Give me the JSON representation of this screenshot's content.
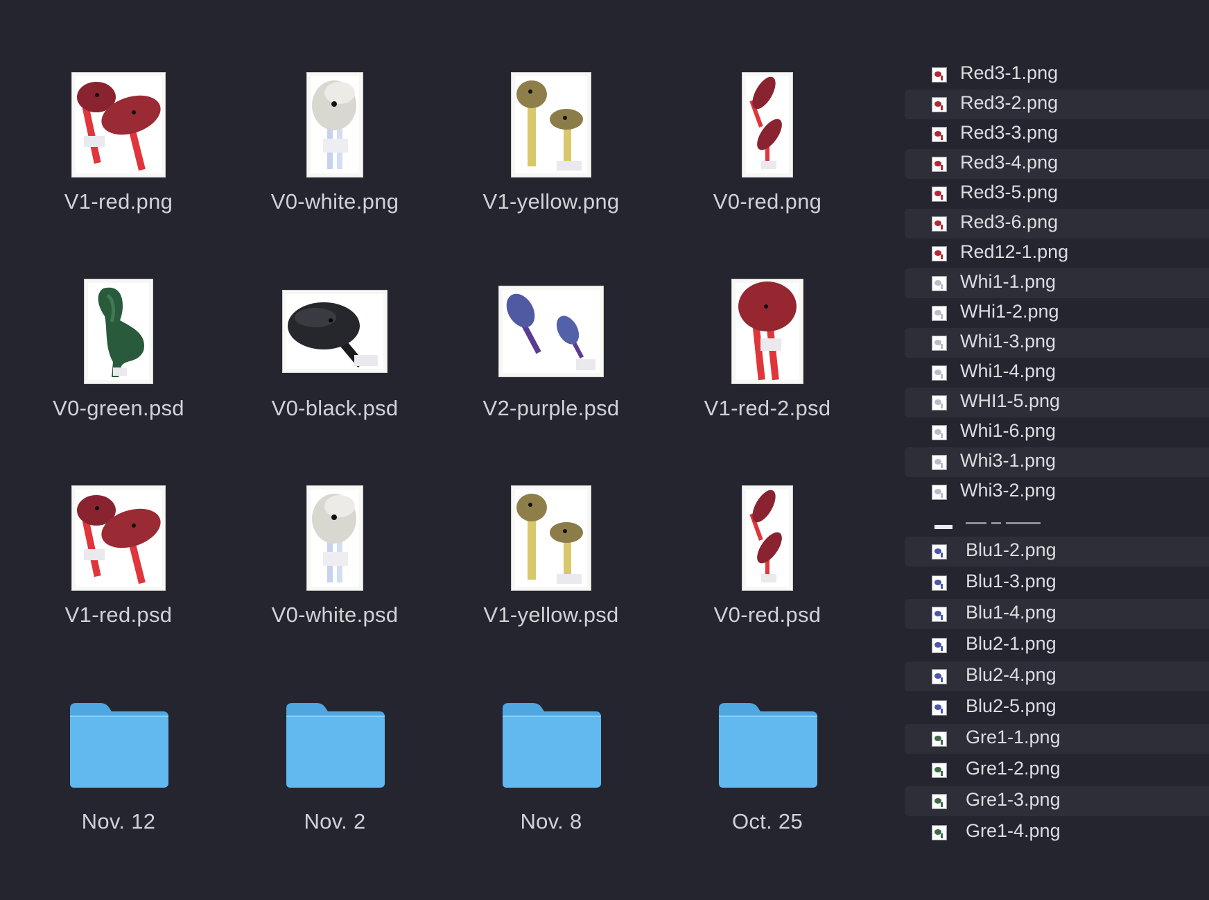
{
  "icon_grid": {
    "items": [
      {
        "name": "V1-red.png",
        "kind": "thumb-red-two-holds"
      },
      {
        "name": "V0-white.png",
        "kind": "thumb-white-hold"
      },
      {
        "name": "V1-yellow.png",
        "kind": "thumb-yellow-two-holds"
      },
      {
        "name": "V0-red.png",
        "kind": "thumb-red-narrow"
      },
      {
        "name": "V0-green.psd",
        "kind": "thumb-green-hold"
      },
      {
        "name": "V0-black.psd",
        "kind": "thumb-black-hold"
      },
      {
        "name": "V2-purple.psd",
        "kind": "thumb-purple-holds"
      },
      {
        "name": "V1-red-2.psd",
        "kind": "thumb-red-single"
      },
      {
        "name": "V1-red.psd",
        "kind": "thumb-red-two-holds"
      },
      {
        "name": "V0-white.psd",
        "kind": "thumb-white-hold"
      },
      {
        "name": "V1-yellow.psd",
        "kind": "thumb-yellow-two-holds"
      },
      {
        "name": "V0-red.psd",
        "kind": "thumb-red-narrow"
      },
      {
        "name": "Nov. 12",
        "kind": "folder-icon"
      },
      {
        "name": "Nov. 2",
        "kind": "folder-icon"
      },
      {
        "name": "Nov. 8",
        "kind": "folder-icon"
      },
      {
        "name": "Oct. 25",
        "kind": "folder-icon"
      }
    ]
  },
  "file_list": {
    "top_items": [
      {
        "name": "Red3-1.png",
        "icon": "red"
      },
      {
        "name": "Red3-2.png",
        "icon": "red"
      },
      {
        "name": "Red3-3.png",
        "icon": "red"
      },
      {
        "name": "Red3-4.png",
        "icon": "red"
      },
      {
        "name": "Red3-5.png",
        "icon": "red"
      },
      {
        "name": "Red3-6.png",
        "icon": "red"
      },
      {
        "name": "Red12-1.png",
        "icon": "red"
      },
      {
        "name": "Whi1-1.png",
        "icon": "white"
      },
      {
        "name": "WHi1-2.png",
        "icon": "white"
      },
      {
        "name": "Whi1-3.png",
        "icon": "white"
      },
      {
        "name": "Whi1-4.png",
        "icon": "white"
      },
      {
        "name": "WHI1-5.png",
        "icon": "white"
      },
      {
        "name": "Whi1-6.png",
        "icon": "white"
      },
      {
        "name": "Whi3-1.png",
        "icon": "white"
      },
      {
        "name": "Whi3-2.png",
        "icon": "white"
      }
    ],
    "bottom_items": [
      {
        "name": "Blu1-2.png",
        "icon": "blue"
      },
      {
        "name": "Blu1-3.png",
        "icon": "blue"
      },
      {
        "name": "Blu1-4.png",
        "icon": "blue"
      },
      {
        "name": "Blu2-1.png",
        "icon": "blue"
      },
      {
        "name": "Blu2-4.png",
        "icon": "blue"
      },
      {
        "name": "Blu2-5.png",
        "icon": "blue"
      },
      {
        "name": "Gre1-1.png",
        "icon": "green"
      },
      {
        "name": "Gre1-2.png",
        "icon": "green"
      },
      {
        "name": "Gre1-3.png",
        "icon": "green"
      },
      {
        "name": "Gre1-4.png",
        "icon": "green"
      }
    ]
  },
  "colors": {
    "background": "#24252f",
    "row_stripe": "#2d2e38",
    "folder": "#62b9ef",
    "folder_tab": "#4fa7e2",
    "label_text": "#d2d2d6"
  }
}
